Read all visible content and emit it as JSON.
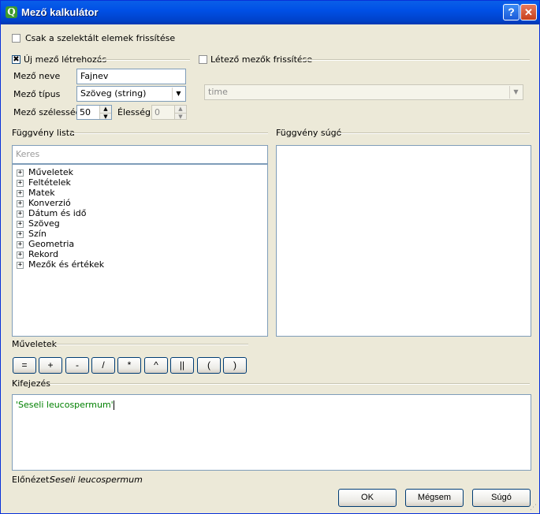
{
  "window": {
    "title": "Mező kalkulátor",
    "help_glyph": "?",
    "close_glyph": "✕",
    "app_icon_glyph": "Q"
  },
  "update_selected": {
    "label": "Csak a szelektált elemek frissítése",
    "checked": false
  },
  "new_field": {
    "group_label": "Új mező létrehozás",
    "checked": true,
    "check_glyph": "✖",
    "name_label": "Mező neve",
    "name_value": "Fajnev",
    "type_label": "Mező típus",
    "type_value": "Szöveg (string)",
    "width_label": "Mező szélesség",
    "width_value": "50",
    "precision_label": "Élesség",
    "precision_value": "0"
  },
  "existing_field": {
    "group_label": "Létező mezők frissítése",
    "checked": false,
    "combo_value": "time"
  },
  "function_list": {
    "group_label": "Függvény lista",
    "search_placeholder": "Keres",
    "items": [
      "Műveletek",
      "Feltételek",
      "Matek",
      "Konverzió",
      "Dátum és idő",
      "Szöveg",
      "Szín",
      "Geometria",
      "Rekord",
      "Mezők és értékek"
    ]
  },
  "function_help": {
    "group_label": "Függvény súgó"
  },
  "operators": {
    "group_label": "Műveletek",
    "buttons": [
      "=",
      "+",
      "-",
      "/",
      "*",
      "^",
      "||",
      "(",
      ")"
    ]
  },
  "expression": {
    "group_label": "Kifejezés",
    "text": "'Seseli leucospermum'",
    "text_color": "#008000"
  },
  "preview": {
    "label": "Előnézet:",
    "value": "Seseli leucospermum"
  },
  "buttons": {
    "ok": "OK",
    "cancel": "Mégsem",
    "help": "Súgó"
  },
  "icons": {
    "expander": "plus-box-icon",
    "arrow": "down-triangle-icon"
  }
}
